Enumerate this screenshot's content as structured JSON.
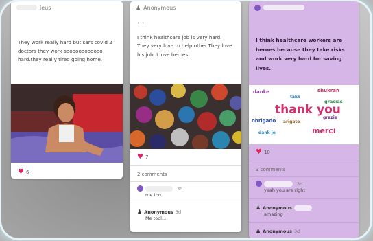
{
  "cards": [
    {
      "header_suffix": "ieus",
      "text": "They work really hard but sars covid 2 doctors they work soooooooooooo hard.they really tired going home.",
      "likes": "6"
    },
    {
      "author": "Anonymous",
      "dots": "• •",
      "text": "I think healthcare job is very hard. They very love to help other.They love his job. I love heroes.",
      "likes": "7",
      "comments_count": "2 comments",
      "comments": [
        {
          "name": "",
          "time": "3d",
          "text": "me too"
        },
        {
          "name": "Anonymous",
          "time": "3d",
          "text": "Me tool..."
        }
      ]
    },
    {
      "text": "I think healthcare workers are heroes because they take risks and work very hard for saving lives.",
      "likes": "10",
      "comments_count": "3 comments",
      "comments": [
        {
          "name": "",
          "time": "3d",
          "text": "yeah you are right"
        },
        {
          "name": "Anonymous",
          "time": "",
          "text": "amazing"
        },
        {
          "name": "Anonymous",
          "time": "3d",
          "text": ""
        }
      ],
      "word_cloud": [
        "thank you",
        "danke",
        "gracias",
        "merci",
        "obrigado",
        "grazie",
        "takk",
        "arigato",
        "shukran",
        "dank je"
      ]
    }
  ],
  "colors": {
    "accent": "#d6b6e6",
    "heart": "#e0245e"
  }
}
